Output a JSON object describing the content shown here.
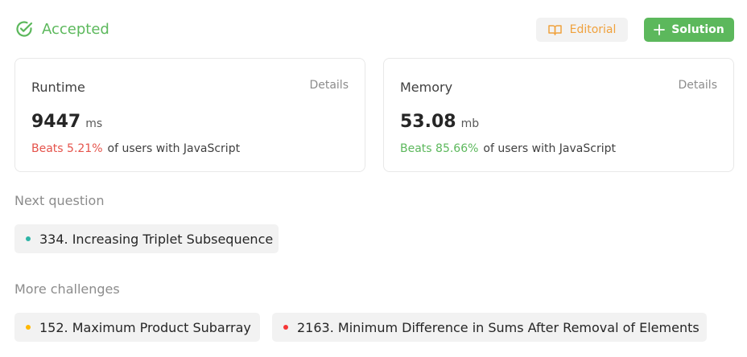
{
  "status": {
    "text": "Accepted",
    "icon": "check-circle-icon",
    "color": "#5cb85c"
  },
  "buttons": {
    "editorial": {
      "label": "Editorial",
      "icon": "book-icon"
    },
    "solution": {
      "label": "Solution",
      "icon": "plus-icon"
    }
  },
  "runtime": {
    "title": "Runtime",
    "details": "Details",
    "value": "9447",
    "unit": "ms",
    "beats": "Beats 5.21%",
    "beats_suffix": "of users with JavaScript"
  },
  "memory": {
    "title": "Memory",
    "details": "Details",
    "value": "53.08",
    "unit": "mb",
    "beats": "Beats 85.66%",
    "beats_suffix": "of users with JavaScript"
  },
  "next_question": {
    "label": "Next question",
    "item": {
      "text": "334. Increasing Triplet Subsequence",
      "dot_color": "#2db4a6"
    }
  },
  "more_challenges": {
    "label": "More challenges",
    "items": [
      {
        "text": "152. Maximum Product Subarray",
        "dot_color": "#ffb800"
      },
      {
        "text": "2163. Minimum Difference in Sums After Removal of Elements",
        "dot_color": "#f63636"
      }
    ]
  }
}
